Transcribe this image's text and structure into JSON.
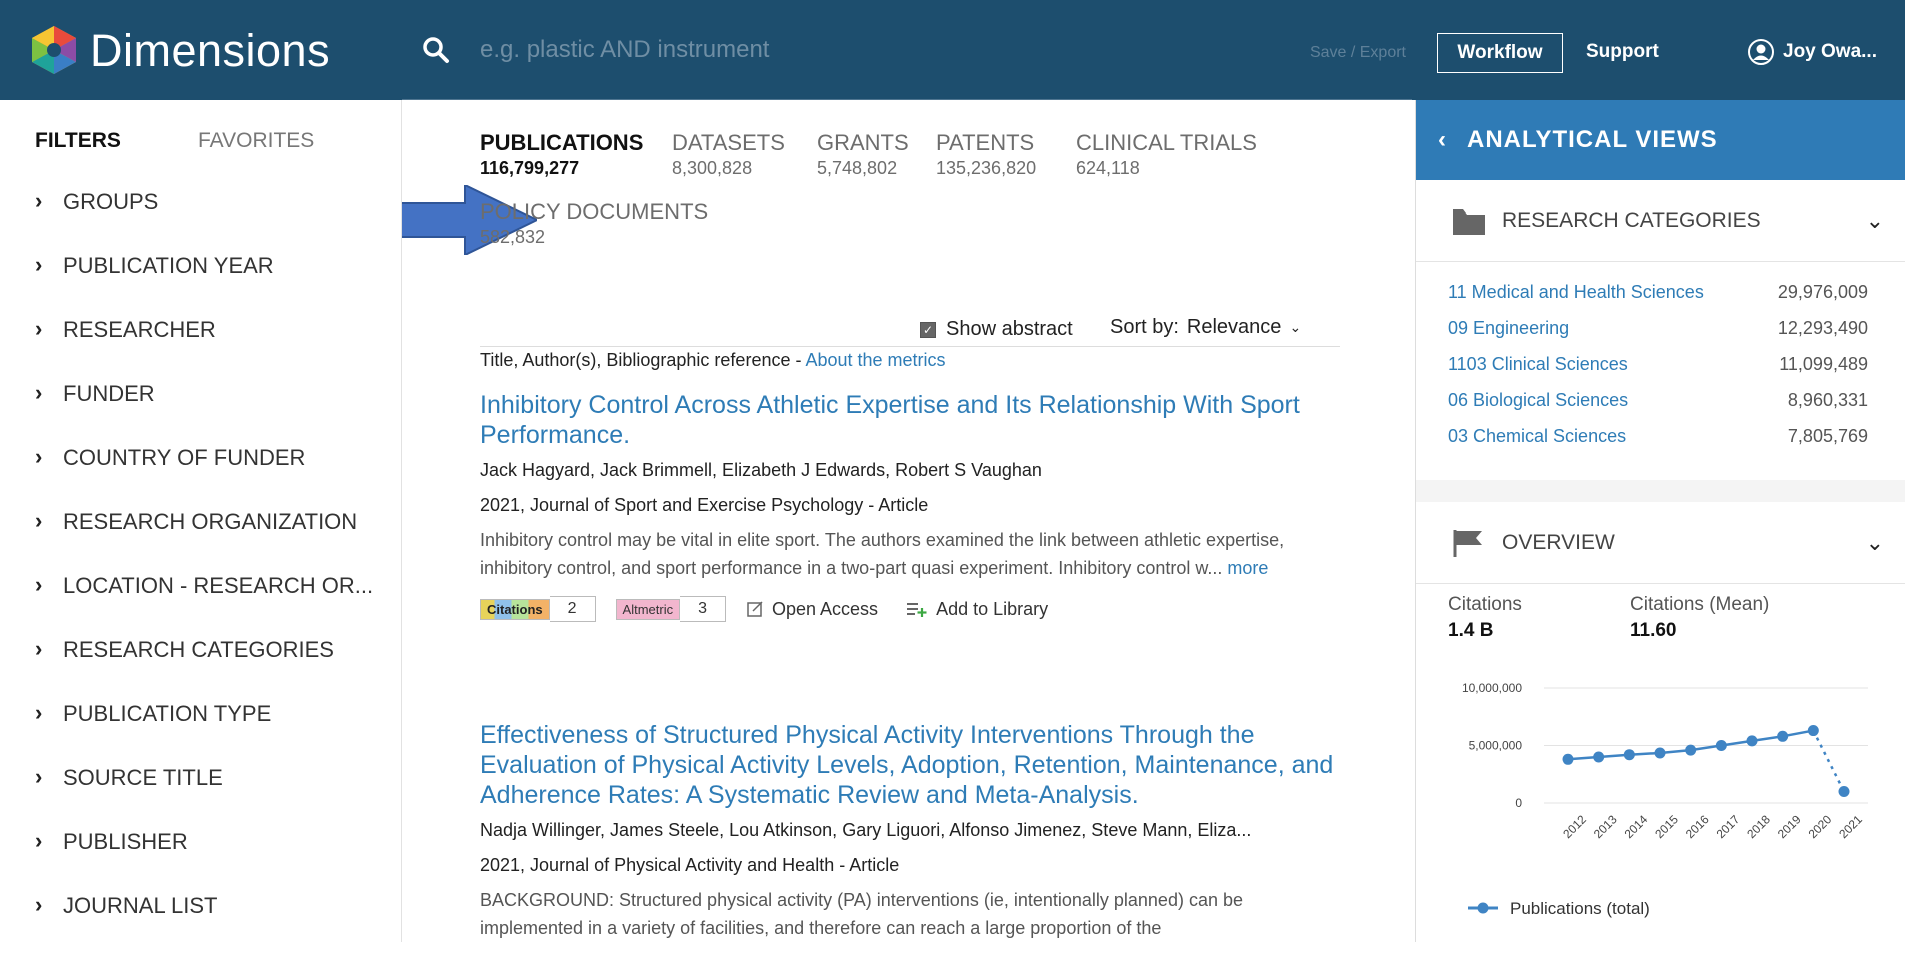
{
  "header": {
    "logo_text": "Dimensions",
    "search_placeholder": "e.g. plastic AND instrument",
    "save_export": "Save / Export",
    "workflow": "Workflow",
    "support": "Support",
    "user_name": "Joy Owa..."
  },
  "sidebar": {
    "tab_filters": "FILTERS",
    "tab_favorites": "FAVORITES",
    "items": [
      {
        "label": "GROUPS"
      },
      {
        "label": "PUBLICATION YEAR"
      },
      {
        "label": "RESEARCHER"
      },
      {
        "label": "FUNDER"
      },
      {
        "label": "COUNTRY OF FUNDER"
      },
      {
        "label": "RESEARCH ORGANIZATION"
      },
      {
        "label": "LOCATION - RESEARCH OR..."
      },
      {
        "label": "RESEARCH CATEGORIES"
      },
      {
        "label": "PUBLICATION TYPE"
      },
      {
        "label": "SOURCE TITLE"
      },
      {
        "label": "PUBLISHER"
      },
      {
        "label": "JOURNAL LIST"
      }
    ]
  },
  "tabs": [
    {
      "label": "PUBLICATIONS",
      "count": "116,799,277"
    },
    {
      "label": "DATASETS",
      "count": "8,300,828"
    },
    {
      "label": "GRANTS",
      "count": "5,748,802"
    },
    {
      "label": "PATENTS",
      "count": "135,236,820"
    },
    {
      "label": "CLINICAL TRIALS",
      "count": "624,118"
    },
    {
      "label": "POLICY DOCUMENTS",
      "count": "582,832"
    }
  ],
  "toolbar": {
    "show_abstract": "Show abstract",
    "show_abstract_checked": true,
    "sort_label": "Sort by:",
    "sort_value": "Relevance",
    "meta_text": "Title, Author(s), Bibliographic reference - ",
    "meta_link": "About the metrics"
  },
  "results": [
    {
      "title": "Inhibitory Control Across Athletic Expertise and Its Relationship With Sport Performance.",
      "authors": "Jack Hagyard, Jack Brimmell, Elizabeth J Edwards, Robert S Vaughan",
      "pub": "2021, Journal of Sport and Exercise Psychology - Article",
      "abstract": "Inhibitory control may be vital in elite sport. The authors examined the link between athletic expertise, inhibitory control, and sport performance in a two-part quasi experiment. Inhibitory control w...",
      "more": "more",
      "citations_label": "Citations",
      "citations": "2",
      "altmetric_label": "Altmetric",
      "altmetric": "3",
      "open_access": "Open Access",
      "add_library": "Add to Library"
    },
    {
      "title": "Effectiveness of Structured Physical Activity Interventions Through the Evaluation of Physical Activity Levels, Adoption, Retention, Maintenance, and Adherence Rates: A Systematic Review and Meta-Analysis.",
      "authors": "Nadja Willinger, James Steele, Lou Atkinson, Gary Liguori, Alfonso Jimenez, Steve Mann, Eliza...",
      "pub": "2021, Journal of Physical Activity and Health - Article",
      "abstract": "BACKGROUND: Structured physical activity (PA) interventions (ie, intentionally planned) can be implemented in a variety of facilities, and therefore can reach a large proportion of the"
    }
  ],
  "analytical": {
    "title": "ANALYTICAL VIEWS",
    "research_categories": {
      "title": "RESEARCH CATEGORIES",
      "items": [
        {
          "name": "11 Medical and Health Sciences",
          "value": "29,976,009"
        },
        {
          "name": "09 Engineering",
          "value": "12,293,490"
        },
        {
          "name": "1103 Clinical Sciences",
          "value": "11,099,489"
        },
        {
          "name": "06 Biological Sciences",
          "value": "8,960,331"
        },
        {
          "name": "03 Chemical Sciences",
          "value": "7,805,769"
        }
      ]
    },
    "overview": {
      "title": "OVERVIEW",
      "citations_label": "Citations",
      "citations_value": "1.4 B",
      "mean_label": "Citations (Mean)",
      "mean_value": "11.60"
    }
  },
  "chart_data": {
    "type": "line",
    "x": [
      "2012",
      "2013",
      "2014",
      "2015",
      "2016",
      "2017",
      "2018",
      "2019",
      "2020",
      "2021"
    ],
    "series": [
      {
        "name": "Publications (total)",
        "values": [
          3800000,
          4000000,
          4200000,
          4350000,
          4600000,
          5000000,
          5400000,
          5800000,
          6300000,
          1000000
        ],
        "dashed_last_segment": true
      }
    ],
    "y_ticks": [
      "10,000,000",
      "5,000,000",
      "0"
    ],
    "y_tick_values": [
      10000000,
      5000000,
      0
    ],
    "ylim": [
      0,
      10000000
    ],
    "grid": true,
    "legend": "bottom",
    "color": "#3f84c4"
  }
}
